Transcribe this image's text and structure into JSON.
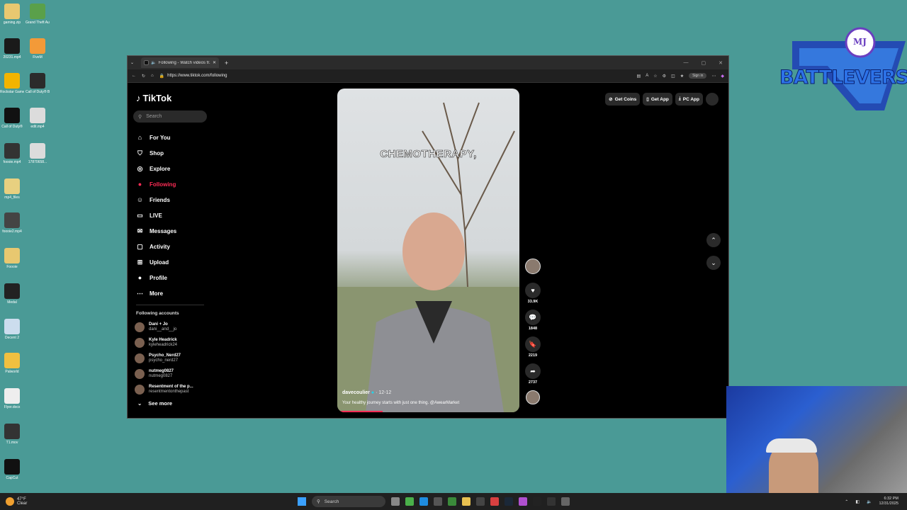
{
  "desktop": {
    "icons": [
      {
        "label": "gaming.zip",
        "color": "#e8c870"
      },
      {
        "label": "Grand Theft Auto V Le...",
        "color": "#5aa04a"
      },
      {
        "label": "20231.mp4",
        "color": "#1a1a1a"
      },
      {
        "label": "FiveM",
        "color": "#f39a38"
      },
      {
        "label": "Rockstar Games ...",
        "color": "#f2b400"
      },
      {
        "label": "Call of Duty® Bla...",
        "color": "#2b2b2b"
      },
      {
        "label": "Call of Duty®",
        "color": "#111"
      },
      {
        "label": "edit.mp4",
        "color": "#dcdcdc"
      },
      {
        "label": "foooie.mp4",
        "color": "#333"
      },
      {
        "label": "17870658...",
        "color": "#dcdcdc"
      },
      {
        "label": "mp4_files",
        "color": "#e8d080"
      },
      {
        "label": "foooie2.mp4",
        "color": "#444"
      },
      {
        "label": "Foooie",
        "color": "#e8c870"
      },
      {
        "label": "Medal",
        "color": "#222"
      },
      {
        "label": "Decent 2",
        "color": "#cde"
      },
      {
        "label": "Palworld",
        "color": "#f0c040"
      },
      {
        "label": "Flyer.docx",
        "color": "#eee"
      },
      {
        "label": "T1.mov",
        "color": "#333"
      },
      {
        "label": "CapCut",
        "color": "#111"
      }
    ]
  },
  "overlay": {
    "logo_text": "BATTLEVERSE",
    "monogram": "MJ"
  },
  "browser": {
    "tab_title": "Following - Watch videos fr...",
    "url": "https://www.tiktok.com/following",
    "sign_in": "Sign in"
  },
  "tiktok": {
    "brand": "TikTok",
    "search_placeholder": "Search",
    "nav": [
      {
        "label": "For You",
        "icon": "home-icon",
        "glyph": "⌂"
      },
      {
        "label": "Shop",
        "icon": "shop-icon",
        "glyph": "⛉"
      },
      {
        "label": "Explore",
        "icon": "compass-icon",
        "glyph": "◎"
      },
      {
        "label": "Following",
        "icon": "following-icon",
        "glyph": "●"
      },
      {
        "label": "Friends",
        "icon": "friends-icon",
        "glyph": "☺"
      },
      {
        "label": "LIVE",
        "icon": "live-icon",
        "glyph": "▭"
      },
      {
        "label": "Messages",
        "icon": "messages-icon",
        "glyph": "✉"
      },
      {
        "label": "Activity",
        "icon": "activity-icon",
        "glyph": "▢"
      },
      {
        "label": "Upload",
        "icon": "upload-icon",
        "glyph": "⊞"
      },
      {
        "label": "Profile",
        "icon": "profile-icon",
        "glyph": "●"
      },
      {
        "label": "More",
        "icon": "more-icon",
        "glyph": "⋯"
      }
    ],
    "active_nav": "Following",
    "following_title": "Following accounts",
    "accounts": [
      {
        "name": "Dani + Jo",
        "handle": "dani__and__jo"
      },
      {
        "name": "Kyle Headrick",
        "handle": "kyleheadrick24"
      },
      {
        "name": "Psycho_Nerd27",
        "handle": "psycho_nerd27"
      },
      {
        "name": "nutmeg0827",
        "handle": "nutmeg0827"
      },
      {
        "name": "Resentment of the p...",
        "handle": "resentmentonthepast"
      }
    ],
    "see_more": "See more",
    "top_actions": {
      "coins": "Get Coins",
      "app": "Get App",
      "pc": "PC App"
    },
    "video": {
      "caption": "CHEMOTHERAPY,",
      "author": "davecoulier",
      "date": "· 12-12",
      "description": "Your healthy journey starts with just one thing. @AwearMarket",
      "progress": 0.25
    },
    "actions": {
      "likes": "33.9K",
      "comments": "1848",
      "saves": "2219",
      "shares": "2737"
    }
  },
  "taskbar": {
    "temp": "47°F",
    "weather": "Clear",
    "search": "Search",
    "time": "6:32 PM",
    "date": "12/31/2025"
  }
}
